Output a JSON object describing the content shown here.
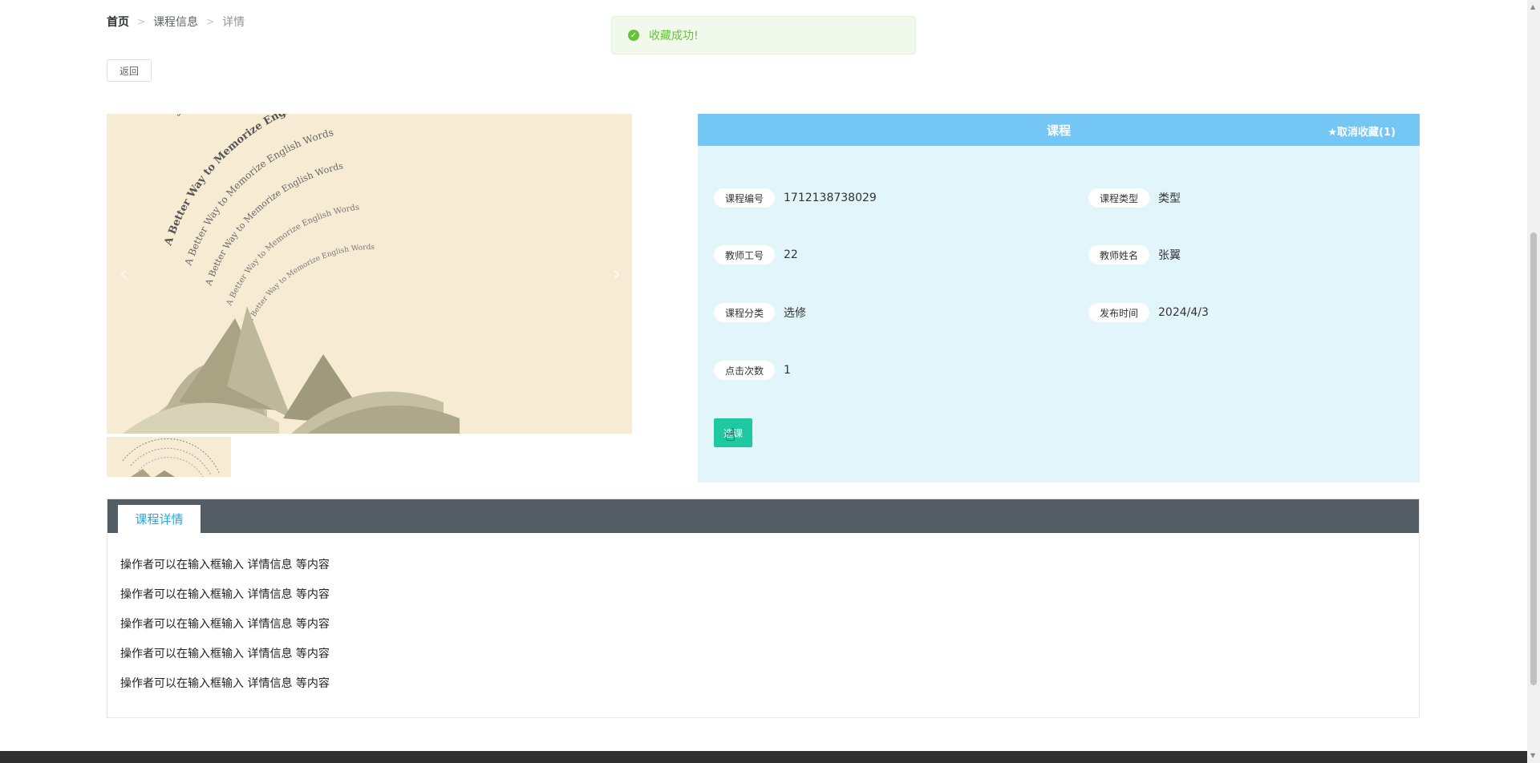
{
  "breadcrumb": {
    "home": "首页",
    "course_info": "课程信息",
    "current": "详情",
    "separator": ">"
  },
  "back_button": "返回",
  "toast": {
    "text": "收藏成功!",
    "icon": "check-circle-icon",
    "color": "#67c23a"
  },
  "gallery": {
    "image_text": "A Better Way to Memorize English Words",
    "arrow_left": "‹",
    "arrow_right": "›"
  },
  "info": {
    "title": "课程",
    "favorite_button": "★取消收藏(1)",
    "header_color": "#74c6f4",
    "panel_color": "#e1f5fb",
    "fields": [
      {
        "label": "课程编号",
        "value": "1712138738029"
      },
      {
        "label": "课程类型",
        "value": "类型"
      },
      {
        "label": "教师工号",
        "value": "22"
      },
      {
        "label": "教师姓名",
        "value": "张翼"
      },
      {
        "label": "课程分类",
        "value": "选修"
      },
      {
        "label": "发布时间",
        "value": "2024/4/3"
      },
      {
        "label": "点击次数",
        "value": "1"
      }
    ],
    "select_button": "选课",
    "select_button_color": "#1ec8a0"
  },
  "details": {
    "tab_label": "课程详情",
    "lines": [
      "操作者可以在输入框输入  详情信息  等内容",
      "操作者可以在输入框输入  详情信息  等内容",
      "操作者可以在输入框输入  详情信息  等内容",
      "操作者可以在输入框输入  详情信息  等内容",
      "操作者可以在输入框输入  详情信息  等内容"
    ]
  }
}
